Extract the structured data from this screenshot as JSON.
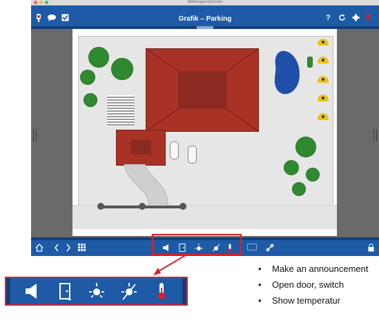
{
  "window": {
    "title": "MxManagementCenter"
  },
  "topbar": {
    "title": "Grafik – Parking",
    "left_icons": [
      "camera-icon",
      "chat-icon",
      "checkbox-icon"
    ],
    "right_icons": [
      "help-icon",
      "refresh-icon",
      "gear-icon",
      "alarm-icon"
    ],
    "help_label": "?"
  },
  "map": {
    "cameras_count": 5,
    "trees_count": 8,
    "colors": {
      "house": "#a93226",
      "tree": "#2f8a2f",
      "pond": "#1f4fa8",
      "camera": "#e8c21a"
    }
  },
  "bottombar": {
    "icons": [
      "home-icon",
      "back-icon",
      "forward-icon",
      "grid-icon",
      "speaker-icon",
      "door-icon",
      "light-on-icon",
      "light-off-icon",
      "thermometer-icon",
      "record-icon",
      "link-icon",
      "lock-icon"
    ]
  },
  "zoom_toolbar": {
    "icons": [
      "speaker-icon",
      "door-icon",
      "light-on-icon",
      "light-off-icon",
      "thermometer-icon"
    ]
  },
  "bullets": [
    "Make an announcement",
    "Open door, switch",
    "Show temperatur"
  ],
  "colors": {
    "accent": "#1e5aa6",
    "highlight": "#e01e25"
  }
}
